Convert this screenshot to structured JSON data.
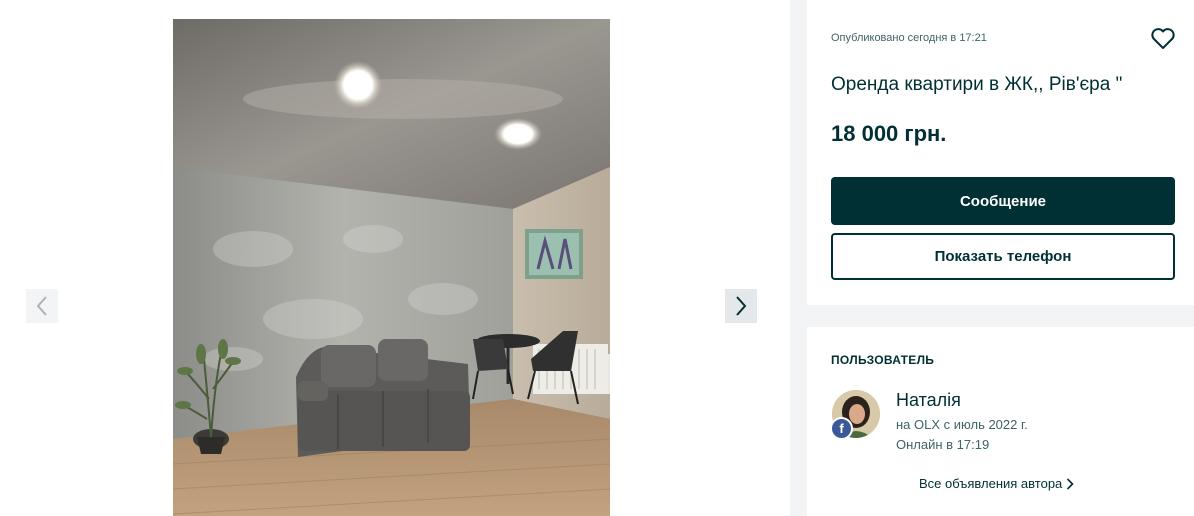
{
  "gallery": {
    "prev_icon": "chevron-left-icon",
    "next_icon": "chevron-right-icon",
    "photo_alt": "Фото квартири"
  },
  "ad": {
    "published": "Опубликовано сегодня в 17:21",
    "favorite_icon": "heart-icon",
    "title": "Оренда квартири в ЖК,, Рів'єра \"",
    "price": "18 000 грн.",
    "message_button": "Сообщение",
    "phone_button": "Показать телефон"
  },
  "user": {
    "heading": "ПОЛЬЗОВАТЕЛЬ",
    "name": "Наталія",
    "since": "на OLX с июль 2022 г.",
    "online": "Онлайн в 17:19",
    "badge": "f",
    "all_ads": "Все объявления автора"
  },
  "colors": {
    "brand_dark": "#002f34",
    "muted_text": "#406367",
    "page_bg": "#f2f4f5",
    "facebook": "#3b5998"
  }
}
